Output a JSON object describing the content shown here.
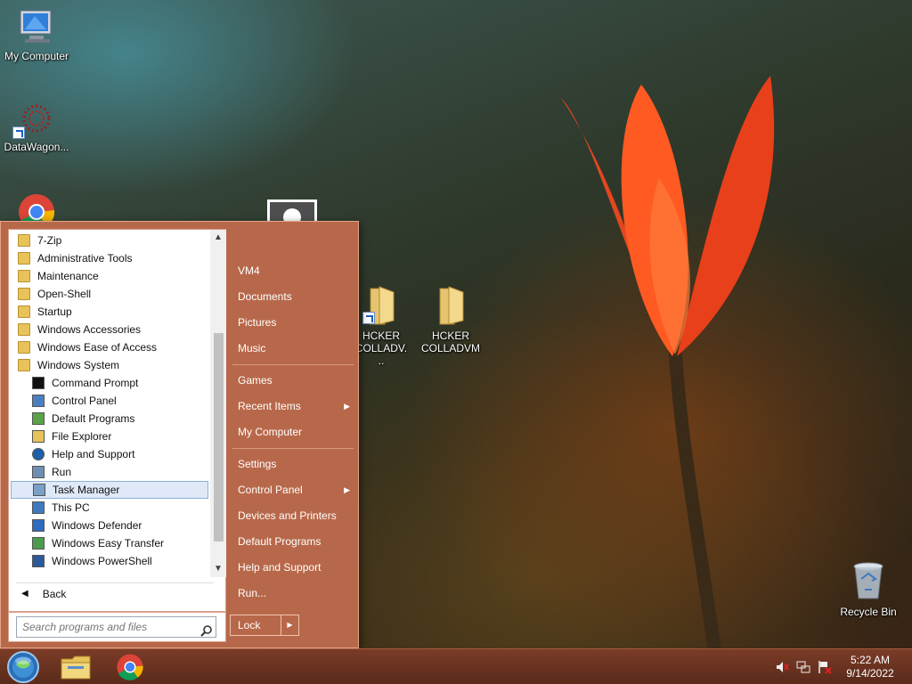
{
  "desktop": {
    "icons": [
      {
        "label": "My Computer",
        "icon": "my-computer-icon"
      },
      {
        "label": "DataWagon...",
        "icon": "datawagon-icon",
        "shortcut": true
      },
      {
        "label": "Google Chrome",
        "icon": "chrome-icon"
      },
      {
        "label": "HCKER COLLADV...",
        "icon": "folder-icon",
        "shortcut": true
      },
      {
        "label": "HCKER COLLADVM",
        "icon": "folder-icon"
      },
      {
        "label": "Recycle Bin",
        "icon": "recycle-bin-icon"
      }
    ]
  },
  "start_menu": {
    "programs": [
      {
        "label": "7-Zip",
        "type": "folder"
      },
      {
        "label": "Administrative Tools",
        "type": "folder"
      },
      {
        "label": "Maintenance",
        "type": "folder"
      },
      {
        "label": "Open-Shell",
        "type": "folder"
      },
      {
        "label": "Startup",
        "type": "folder"
      },
      {
        "label": "Windows Accessories",
        "type": "folder"
      },
      {
        "label": "Windows Ease of Access",
        "type": "folder"
      },
      {
        "label": "Windows System",
        "type": "folder"
      },
      {
        "label": "Command Prompt",
        "type": "app",
        "icon": "command-prompt-icon"
      },
      {
        "label": "Control Panel",
        "type": "app",
        "icon": "control-panel-icon"
      },
      {
        "label": "Default Programs",
        "type": "app",
        "icon": "default-programs-icon"
      },
      {
        "label": "File Explorer",
        "type": "app",
        "icon": "file-explorer-icon"
      },
      {
        "label": "Help and Support",
        "type": "app",
        "icon": "help-icon"
      },
      {
        "label": "Run",
        "type": "app",
        "icon": "run-icon"
      },
      {
        "label": "Task Manager",
        "type": "app",
        "icon": "task-manager-icon",
        "selected": true
      },
      {
        "label": "This PC",
        "type": "app",
        "icon": "this-pc-icon"
      },
      {
        "label": "Windows Defender",
        "type": "app",
        "icon": "windows-defender-icon"
      },
      {
        "label": "Windows Easy Transfer",
        "type": "app",
        "icon": "easy-transfer-icon"
      },
      {
        "label": "Windows PowerShell",
        "type": "app",
        "icon": "powershell-icon"
      }
    ],
    "back_label": "Back",
    "search_placeholder": "Search programs and files",
    "right_items": [
      {
        "label": "VM4"
      },
      {
        "label": "Documents"
      },
      {
        "label": "Pictures"
      },
      {
        "label": "Music"
      },
      {
        "label": "Games"
      },
      {
        "label": "Recent Items",
        "submenu": true
      },
      {
        "label": "My Computer"
      },
      {
        "label": "Settings"
      },
      {
        "label": "Control Panel",
        "submenu": true
      },
      {
        "label": "Devices and Printers"
      },
      {
        "label": "Default Programs"
      },
      {
        "label": "Help and Support"
      },
      {
        "label": "Run..."
      }
    ],
    "lock_label": "Lock"
  },
  "taskbar": {
    "time": "5:22 AM",
    "date": "9/14/2022"
  },
  "colors": {
    "menu_bg": "#b8684a",
    "taskbar": "#6a3322",
    "selection": "#dfe9f7"
  }
}
